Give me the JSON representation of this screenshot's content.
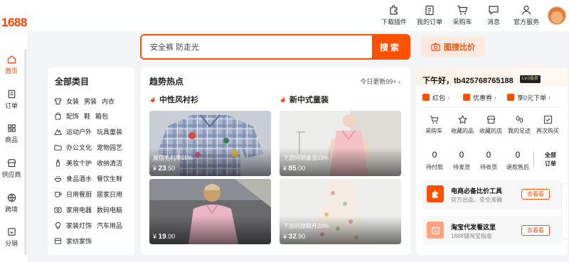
{
  "app": {
    "logo": "1688"
  },
  "topnav": [
    {
      "label": "下载插件",
      "icon": "puzzle-icon"
    },
    {
      "label": "我的订单",
      "icon": "clipboard-icon"
    },
    {
      "label": "采购车",
      "icon": "cart-icon"
    },
    {
      "label": "消息",
      "icon": "message-icon"
    },
    {
      "label": "官方服务",
      "icon": "user-icon"
    }
  ],
  "sidebar": [
    {
      "label": "首页",
      "icon": "home-icon",
      "active": true
    },
    {
      "label": "订单",
      "icon": "order-icon"
    },
    {
      "label": "商品",
      "icon": "grid-icon"
    },
    {
      "label": "供应商",
      "icon": "store-icon"
    },
    {
      "label": "跨境",
      "icon": "globe-icon"
    },
    {
      "label": "分销",
      "icon": "box-icon"
    }
  ],
  "search": {
    "value": "安全裤 防走光",
    "button": "搜索",
    "image_search": "图搜比价"
  },
  "categories": {
    "title": "全部类目",
    "rows": [
      {
        "icon": "tshirt-icon",
        "items": [
          "女装",
          "男装",
          "内衣"
        ]
      },
      {
        "icon": "bag-icon",
        "items": [
          "配饰",
          "鞋",
          "箱包"
        ]
      },
      {
        "icon": "outdoor-icon",
        "items": [
          "运动户外",
          "玩具童装"
        ]
      },
      {
        "icon": "folder-icon",
        "items": [
          "办公文化",
          "宠物园艺"
        ]
      },
      {
        "icon": "beauty-icon",
        "items": [
          "美妆个护",
          "收纳清洁"
        ]
      },
      {
        "icon": "food-icon",
        "items": [
          "食品酒水",
          "餐饮生鲜"
        ]
      },
      {
        "icon": "cup-icon",
        "items": [
          "日用餐厨",
          "居家日用"
        ]
      },
      {
        "icon": "camera-icon",
        "items": [
          "家用电器",
          "数码电脑"
        ]
      },
      {
        "icon": "lamp-icon",
        "items": [
          "家装灯饰",
          "汽车用品"
        ]
      },
      {
        "icon": "textile-icon",
        "items": [
          "家纺家饰"
        ]
      }
    ]
  },
  "trends": {
    "title": "趋势热点",
    "update": "今日更新99+",
    "groups": [
      {
        "title": "中性风衬衫",
        "products": [
          {
            "label": "展信毛利率55%",
            "price_int": "23",
            "price_dec": ".50"
          },
          {
            "label": "",
            "price_int": "19",
            "price_dec": ".00"
          }
        ]
      },
      {
        "title": "新中式童装",
        "products": [
          {
            "label": "下游同销量涨53%",
            "price_int": "85",
            "price_dec": ".00"
          },
          {
            "label": "下游同搜飙升20%",
            "price_int": "32",
            "price_dec": ".90"
          }
        ]
      }
    ],
    "currency": "¥"
  },
  "user": {
    "greeting": "下午好，tb425768765188",
    "level": "Lv.0会员",
    "assets": [
      {
        "label": "红包",
        "caret": "›"
      },
      {
        "label": "优惠券",
        "caret": "›"
      },
      {
        "label": "享0元下单",
        "caret": "›"
      }
    ],
    "quick": [
      {
        "label": "采购车",
        "icon": "cart-icon"
      },
      {
        "label": "收藏的品",
        "icon": "star-icon"
      },
      {
        "label": "收藏的店",
        "icon": "shop-icon"
      },
      {
        "label": "我的足迹",
        "icon": "footprint-icon"
      },
      {
        "label": "再次购买",
        "icon": "checkbox-icon"
      }
    ],
    "stats": [
      {
        "num": "0",
        "label": "待付款"
      },
      {
        "num": "0",
        "label": "待发货"
      },
      {
        "num": "0",
        "label": "待收货"
      },
      {
        "num": "0",
        "label": "退款售后"
      }
    ],
    "all_orders_line1": "全部",
    "all_orders_line2": "订单",
    "tools": [
      {
        "title": "电商必备比价工具",
        "sub": "官方出品，安全准确",
        "btn": "去看看"
      },
      {
        "title": "淘宝代发看这里",
        "sub": "1688铺淘宝指南",
        "btn": "去看看"
      }
    ]
  },
  "colors": {
    "accent": "#ff5000",
    "logo": "#ff4000",
    "background": "#f3f4f6"
  }
}
